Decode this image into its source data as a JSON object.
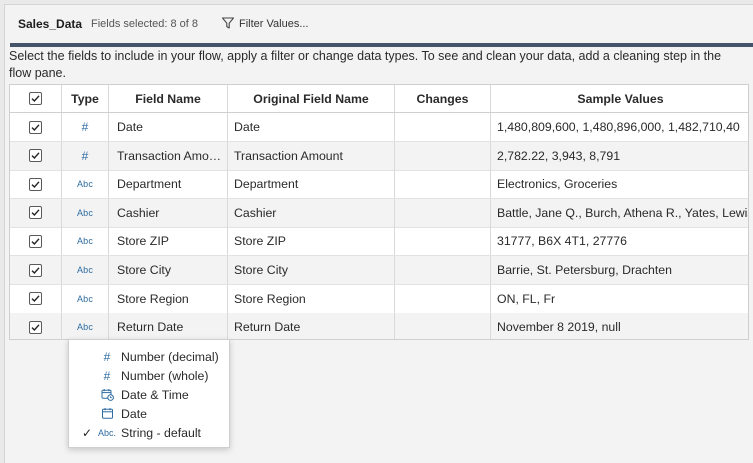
{
  "header": {
    "title": "Sales_Data",
    "fields_selected": "Fields selected: 8 of 8",
    "filter_label": "Filter Values..."
  },
  "instruction": "Select the fields to include in your flow, apply a filter or change data types. To see and clean your data, add a cleaning step in the flow pane.",
  "columns": {
    "type": "Type",
    "field_name": "Field Name",
    "original_field_name": "Original Field Name",
    "changes": "Changes",
    "sample_values": "Sample Values"
  },
  "rows": [
    {
      "type_icon": "#",
      "type": "number",
      "field": "Date",
      "original": "Date",
      "changes": "",
      "sample": "1,480,809,600, 1,480,896,000, 1,482,710,40"
    },
    {
      "type_icon": "#",
      "type": "number",
      "field": "Transaction Amo…",
      "original": "Transaction Amount",
      "changes": "",
      "sample": "2,782.22, 3,943, 8,791"
    },
    {
      "type_icon": "Abc",
      "type": "string",
      "field": "Department",
      "original": "Department",
      "changes": "",
      "sample": "Electronics, Groceries"
    },
    {
      "type_icon": "Abc",
      "type": "string",
      "field": "Cashier",
      "original": "Cashier",
      "changes": "",
      "sample": "Battle, Jane Q., Burch, Athena R., Yates, Lewis"
    },
    {
      "type_icon": "Abc",
      "type": "string",
      "field": "Store ZIP",
      "original": "Store ZIP",
      "changes": "",
      "sample": "31777, B6X 4T1, 27776"
    },
    {
      "type_icon": "Abc",
      "type": "string",
      "field": "Store City",
      "original": "Store City",
      "changes": "",
      "sample": "Barrie, St. Petersburg, Drachten"
    },
    {
      "type_icon": "Abc",
      "type": "string",
      "field": "Store Region",
      "original": "Store Region",
      "changes": "",
      "sample": "ON, FL, Fr"
    },
    {
      "type_icon": "Abc",
      "type": "string",
      "field": "Return Date",
      "original": "Return Date",
      "changes": "",
      "sample": "November 8 2019, null"
    }
  ],
  "type_menu": [
    {
      "icon": "hash-icon",
      "glyph": "#",
      "label": "Number (decimal)",
      "checked": false
    },
    {
      "icon": "hash-icon",
      "glyph": "#",
      "label": "Number (whole)",
      "checked": false
    },
    {
      "icon": "datetime-icon",
      "glyph": "",
      "label": "Date & Time",
      "checked": false
    },
    {
      "icon": "calendar-icon",
      "glyph": "",
      "label": "Date",
      "checked": false
    },
    {
      "icon": "abc-icon",
      "glyph": "Abc.",
      "label": "String - default",
      "checked": true
    }
  ],
  "colors": {
    "accent_bar": "#44546a",
    "type_icon": "#2d6ca2"
  }
}
